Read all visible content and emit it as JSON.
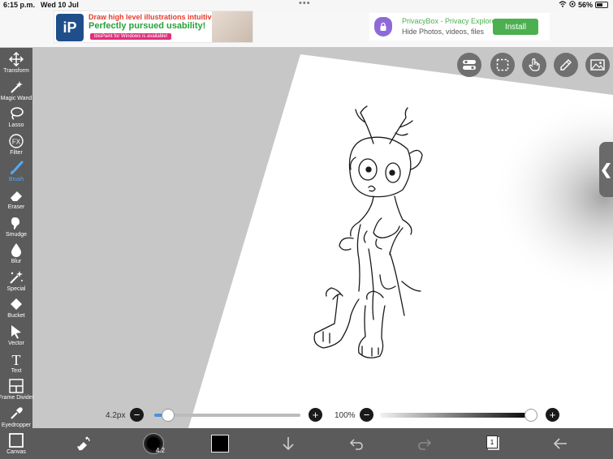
{
  "status_bar": {
    "time": "6:15 p.m.",
    "date": "Wed 10 Jul",
    "battery": "56%"
  },
  "ads": {
    "ibis": {
      "line1": "Draw high level illustrations intuitively!",
      "line2": "Perfectly pursued usability!",
      "line3": "ibisPaint for Windows is available!",
      "logo_text": "iP"
    },
    "privacybox": {
      "title": "PrivacyBox - Privacy Explorer",
      "subtitle": "Hide Photos, videos, files",
      "button": "Install"
    }
  },
  "tools": [
    {
      "id": "transform",
      "label": "Transform",
      "icon": "move-icon"
    },
    {
      "id": "magic-wand",
      "label": "Magic Wand",
      "icon": "magic-wand-icon"
    },
    {
      "id": "lasso",
      "label": "Lasso",
      "icon": "lasso-icon"
    },
    {
      "id": "filter",
      "label": "Filter",
      "icon": "fx-icon"
    },
    {
      "id": "brush",
      "label": "Brush",
      "icon": "brush-icon",
      "active": true
    },
    {
      "id": "eraser",
      "label": "Eraser",
      "icon": "eraser-icon"
    },
    {
      "id": "smudge",
      "label": "Smudge",
      "icon": "smudge-icon"
    },
    {
      "id": "blur",
      "label": "Blur",
      "icon": "droplet-icon"
    },
    {
      "id": "special",
      "label": "Special",
      "icon": "sparkle-icon"
    },
    {
      "id": "bucket",
      "label": "Bucket",
      "icon": "bucket-icon"
    },
    {
      "id": "vector",
      "label": "Vector",
      "icon": "cursor-icon"
    },
    {
      "id": "text",
      "label": "Text",
      "icon": "text-icon"
    },
    {
      "id": "frame-divider",
      "label": "Frame Divider",
      "icon": "frame-icon"
    },
    {
      "id": "eyedropper",
      "label": "Eyedropper",
      "icon": "eyedropper-icon"
    },
    {
      "id": "canvas",
      "label": "Canvas",
      "icon": "canvas-icon"
    }
  ],
  "brush": {
    "size_label": "4.2px",
    "size_fraction": 0.07,
    "opacity_label": "100%",
    "opacity_fraction": 1.0,
    "preview_label": "4.2",
    "color": "#000000"
  },
  "layers": {
    "count": "1"
  },
  "colors": {
    "toolbar_bg": "#5b5b5b",
    "accent": "#56a9ff"
  }
}
